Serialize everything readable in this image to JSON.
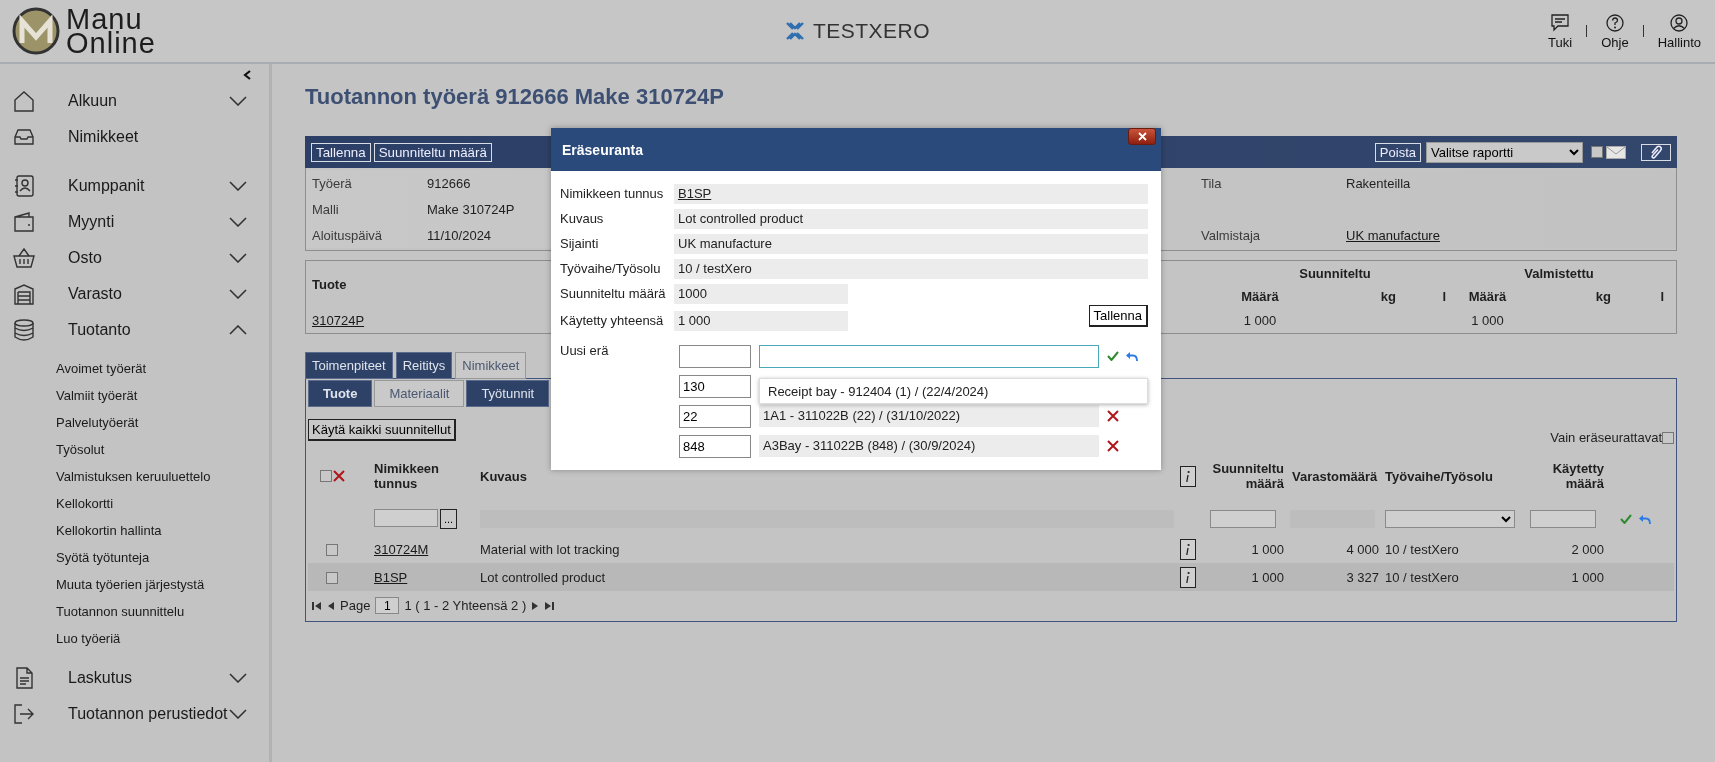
{
  "header": {
    "logo": [
      "Manu",
      "Online"
    ],
    "company": "TESTXERO",
    "actions": [
      "Tuki",
      "Ohje",
      "Hallinto"
    ]
  },
  "sidebar": {
    "groups": [
      [
        {
          "label": "Alkuun",
          "expanded": false
        },
        {
          "label": "Nimikkeet"
        }
      ],
      [
        {
          "label": "Kumppanit",
          "expanded": false
        },
        {
          "label": "Myynti",
          "expanded": false
        },
        {
          "label": "Osto",
          "expanded": false
        },
        {
          "label": "Varasto",
          "expanded": false
        },
        {
          "label": "Tuotanto",
          "expanded": true,
          "children": [
            {
              "label": "Avoimet työerät"
            },
            {
              "label": "Valmiit työerät"
            },
            {
              "label": "Palvelutyöerät"
            },
            {
              "label": "Työsolut"
            },
            {
              "label": "Valmistuksen keruuluettelo"
            },
            {
              "label": "Kellokortti"
            },
            {
              "label": "Kellokortin hallinta"
            },
            {
              "label": "Syötä työtunteja"
            },
            {
              "label": "Muuta työerien järjestystä"
            },
            {
              "label": "Tuotannon suunnittelu"
            },
            {
              "label": "Luo työeriä"
            }
          ]
        },
        {
          "label": "Laskutus",
          "expanded": false
        },
        {
          "label": "Tuotannon perustiedot",
          "expanded": false
        }
      ]
    ]
  },
  "page_title": "Tuotannon työerä 912666 Make 310724P",
  "toolbar": {
    "buttons": [
      "Tallenna",
      "Suunniteltu määrä"
    ],
    "delete_button": "Poista",
    "report": "Valitse raportti",
    "email_checked": false
  },
  "info": [
    {
      "label": "Työerä",
      "value": "912666",
      "right_label": "Tila",
      "right_value": "Rakenteilla"
    },
    {
      "label": "Malli",
      "value": "Make 310724P"
    },
    {
      "label": "Aloituspäivä",
      "value": "11/10/2024",
      "right_label": "Valmistaja",
      "right_value": "UK manufacture",
      "right_link": true
    }
  ],
  "product_table": {
    "column_1": "Tuote",
    "groups": [
      "Suunniteltu",
      "Valmistettu"
    ],
    "units": [
      "Määrä",
      "kg",
      "l",
      "Määrä",
      "kg",
      "l"
    ],
    "rows": [
      {
        "product": "310724P",
        "planned": "1 000",
        "made": "1 000"
      }
    ]
  },
  "tabs": [
    {
      "label": "Toimenpiteet",
      "selected": false
    },
    {
      "label": "Reititys",
      "selected": false
    },
    {
      "label": "Nimikkeet",
      "selected": true
    }
  ],
  "subtabs": [
    {
      "label": "Tuote",
      "selected": false
    },
    {
      "label": "Materiaalit",
      "selected": true
    },
    {
      "label": "Työtunnit",
      "selected": false
    }
  ],
  "materials": {
    "use_all_button": "Käytä kaikki suunnitellut",
    "lot_only": {
      "label": "Vain eräseurattavat",
      "checked": false
    },
    "select_all_checked": false,
    "columns": [
      "Nimikkeen tunnus",
      "Kuvaus",
      "Suunniteltu määrä",
      "Varastomäärä",
      "Työvaihe/Työsolu",
      "Käytetty määrä"
    ],
    "filter_button": "...",
    "rows": [
      {
        "checked": false,
        "code": "310724M",
        "description": "Material with lot tracking",
        "planned": "1 000",
        "stock": "4 000",
        "phase": "10 / testXero",
        "used": "2 000"
      },
      {
        "checked": false,
        "code": "B1SP",
        "description": "Lot controlled product",
        "planned": "1 000",
        "stock": "3 327",
        "phase": "10 / testXero",
        "used": "1 000"
      }
    ],
    "pager": {
      "label": "Page",
      "page": "1",
      "summary": "1 ( 1 - 2 Yhteensä 2 )"
    }
  },
  "dialog": {
    "title": "Eräseuranta",
    "fields": [
      {
        "label": "Nimikkeen tunnus",
        "value": "B1SP",
        "kind": "link"
      },
      {
        "label": "Kuvaus",
        "value": "Lot controlled product",
        "kind": "text"
      },
      {
        "label": "Sijainti",
        "value": "UK manufacture",
        "kind": "text"
      },
      {
        "label": "Työvaihe/Työsolu",
        "value": "10 / testXero",
        "kind": "text"
      },
      {
        "label": "Suunniteltu määrä",
        "value": "1000",
        "kind": "short"
      },
      {
        "label": "Käytetty yhteensä",
        "value": "1 000",
        "kind": "short"
      }
    ],
    "save_button": "Tallenna",
    "new_lot_label": "Uusi erä",
    "suggestion": "Receipt bay - 912404 (1) / (22/4/2024)",
    "lots": [
      {
        "quantity": "130"
      },
      {
        "quantity": "22",
        "lot": "1A1 - 311022B (22) / (31/10/2022)"
      },
      {
        "quantity": "848",
        "lot": "A3Bay - 311022B (848) / (30/9/2024)"
      }
    ]
  }
}
